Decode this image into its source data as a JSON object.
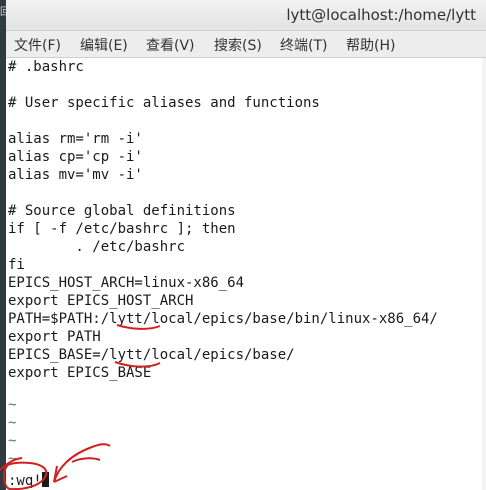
{
  "window": {
    "title": "lytt@localhost:/home/lytt",
    "desktop_glyph": "回"
  },
  "menu": [
    "文件(F)",
    "编辑(E)",
    "查看(V)",
    "搜索(S)",
    "终端(T)",
    "帮助(H)"
  ],
  "editor": {
    "lines": [
      "# .bashrc",
      "",
      "# User specific aliases and functions",
      "",
      "alias rm='rm -i'",
      "alias cp='cp -i'",
      "alias mv='mv -i'",
      "",
      "# Source global definitions",
      "if [ -f /etc/bashrc ]; then",
      "        . /etc/bashrc",
      "fi",
      "EPICS_HOST_ARCH=linux-x86_64",
      "export EPICS_HOST_ARCH",
      "PATH=$PATH:/lytt/local/epics/base/bin/linux-x86_64/",
      "export PATH",
      "EPICS_BASE=/lytt/local/epics/base/",
      "export EPICS_BASE",
      "",
      "~",
      "~",
      "~",
      "~"
    ],
    "command": ":wq!"
  },
  "colors": {
    "annotation": "#d21f1f",
    "text": "#1a1a1a",
    "menubar": "#ededed"
  }
}
